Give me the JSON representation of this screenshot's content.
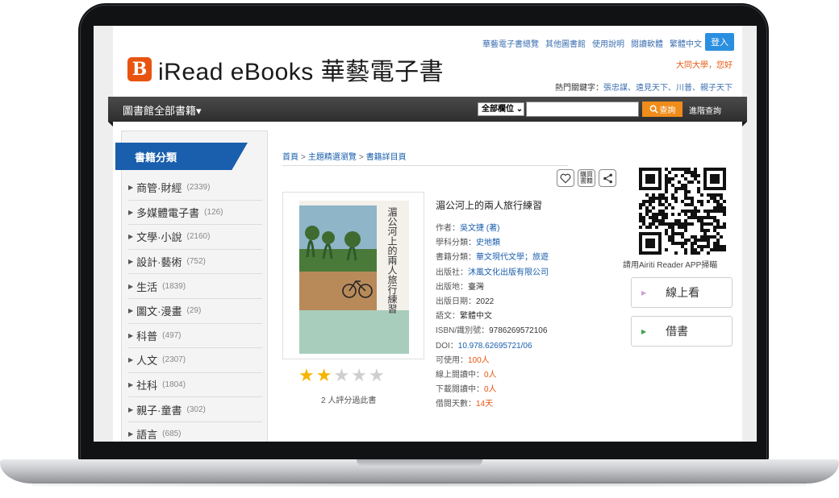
{
  "header": {
    "logo_mark": "B",
    "logo_text": "iRead eBooks 華藝電子書",
    "top_links": [
      "華藝電子書總覽",
      "其他圖書館",
      "使用說明",
      "閱讀軟體",
      "繁體中文"
    ],
    "login_label": "登入",
    "university": "大同大學，您好",
    "hot_keywords_label": "熱門關鍵字：",
    "hot_keywords": "張忠謀、遠見天下、川普、親子天下"
  },
  "navbar": {
    "all_books": "圖書館全部書籍▾",
    "field_select": "全部欄位",
    "search_label": "查詢",
    "advanced_search": "進階查詢"
  },
  "sidebar": {
    "title": "書籍分類",
    "categories": [
      {
        "name": "商管·財經",
        "count": "(2339)"
      },
      {
        "name": "多媒體電子書",
        "count": "(126)"
      },
      {
        "name": "文學·小說",
        "count": "(2160)"
      },
      {
        "name": "設計·藝術",
        "count": "(752)"
      },
      {
        "name": "生活",
        "count": "(1839)"
      },
      {
        "name": "圖文·漫畫",
        "count": "(29)"
      },
      {
        "name": "科普",
        "count": "(497)"
      },
      {
        "name": "人文",
        "count": "(2307)"
      },
      {
        "name": "社科",
        "count": "(1804)"
      },
      {
        "name": "親子·童書",
        "count": "(302)"
      },
      {
        "name": "語言",
        "count": "(685)"
      }
    ]
  },
  "breadcrumb": [
    "首頁",
    "主題精選瀏覽",
    "書籍詳目頁"
  ],
  "actions": {
    "recommend": "購買\n書籍"
  },
  "book": {
    "cover_title": "湄公河上的兩人旅行練習",
    "title": "湄公河上的兩人旅行練習",
    "rating": 2,
    "rating_max": 5,
    "rating_text": "2 人評分過此書",
    "meta": {
      "author_label": "作者：",
      "author": "吳文捷 (著)",
      "subject_label": "學科分類：",
      "subject": "史地類",
      "category_label": "書籍分類：",
      "category": "華文現代文學；旅遊",
      "publisher_label": "出版社：",
      "publisher": "沐風文化出版有限公司",
      "place_label": "出版地：",
      "place": "臺灣",
      "date_label": "出版日期：",
      "date": "2022",
      "lang_label": "語文：",
      "lang": "繁體中文",
      "isbn_label": "ISBN/識別號：",
      "isbn": "9786269572106",
      "doi_label": "DOI：",
      "doi": "10.978.62695721/06",
      "available_label": "可使用：",
      "available": "100人",
      "online_label": "線上閱讀中：",
      "online": "0人",
      "download_label": "下載閱讀中：",
      "download": "0人",
      "loan_label": "借閱天數：",
      "loan": "14天"
    }
  },
  "qr": {
    "caption": "請用Airiti Reader APP掃瞄"
  },
  "buttons": {
    "read_online": "線上看",
    "borrow": "借書"
  },
  "colors": {
    "brand_orange": "#e8540f",
    "link_blue": "#1a5fad",
    "nav_dark": "#3a3a3a",
    "star_gold": "#f5b400"
  }
}
